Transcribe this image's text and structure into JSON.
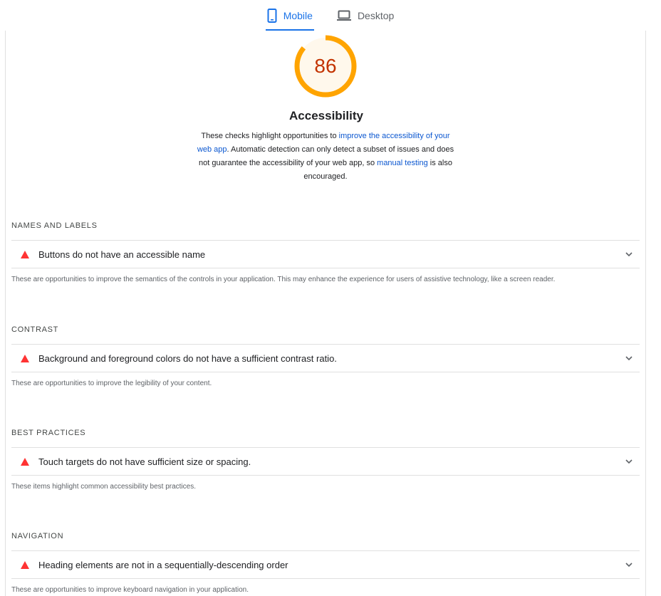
{
  "tabs": [
    {
      "label": "Mobile",
      "icon": "phone-icon",
      "active": true
    },
    {
      "label": "Desktop",
      "icon": "laptop-icon",
      "active": false
    }
  ],
  "gauge": {
    "score": "86",
    "fraction": 0.86,
    "color": "#ffa400"
  },
  "category": {
    "title": "Accessibility",
    "desc_1": "These checks highlight opportunities to ",
    "link_1": "improve the accessibility of your web app",
    "desc_2": ". Automatic detection can only detect a subset of issues and does not guarantee the accessibility of your web app, so ",
    "link_2": "manual testing",
    "desc_3": " is also encouraged."
  },
  "groups": [
    {
      "header": "NAMES AND LABELS",
      "audit": "Buttons do not have an accessible name",
      "description": "These are opportunities to improve the semantics of the controls in your application. This may enhance the experience for users of assistive technology, like a screen reader."
    },
    {
      "header": "CONTRAST",
      "audit": "Background and foreground colors do not have a sufficient contrast ratio.",
      "description": "These are opportunities to improve the legibility of your content."
    },
    {
      "header": "BEST PRACTICES",
      "audit": "Touch targets do not have sufficient size or spacing.",
      "description": "These items highlight common accessibility best practices."
    },
    {
      "header": "NAVIGATION",
      "audit": "Heading elements are not in a sequentially-descending order",
      "description": "These are opportunities to improve keyboard navigation in your application."
    }
  ],
  "colors": {
    "accent": "#1a73e8",
    "fail": "#ff3333",
    "score_average": "#ffa400"
  }
}
